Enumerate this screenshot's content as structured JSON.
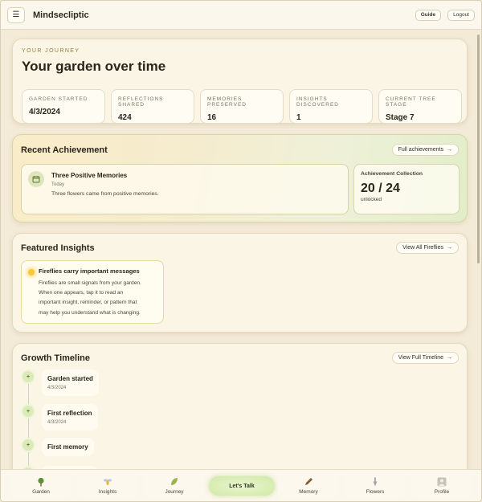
{
  "app": {
    "name": "Mindsecliptic",
    "guide_label": "Guide",
    "logout_label": "Logout"
  },
  "journey": {
    "eyebrow": "YOUR JOURNEY",
    "title": "Your garden over time",
    "stats": [
      {
        "label": "GARDEN STARTED",
        "value": "4/3/2024"
      },
      {
        "label": "REFLECTIONS SHARED",
        "value": "424"
      },
      {
        "label": "MEMORIES PRESERVED",
        "value": "16"
      },
      {
        "label": "INSIGHTS DISCOVERED",
        "value": "1"
      },
      {
        "label": "CURRENT TREE STAGE",
        "value": "Stage 7"
      }
    ]
  },
  "achievement": {
    "title": "Recent Achievement",
    "link_label": "Full achievements",
    "memory_title": "Three Positive Memories",
    "memory_date": "Today",
    "memory_desc": "Three flowers came from positive memories.",
    "collection_label": "Achievement Collection",
    "collection_value": "20 / 24",
    "collection_sub": "unlocked"
  },
  "insights": {
    "title": "Featured Insights",
    "link_label": "View All Fireflies",
    "firefly_title": "Fireflies carry important messages",
    "firefly_lines": [
      "Fireflies are small signals from your garden.",
      "When one appears, tap it to read an",
      "important insight, reminder, or pattern that",
      "may help you understand what is changing."
    ]
  },
  "timeline": {
    "title": "Growth Timeline",
    "link_label": "View Full Timeline",
    "items": [
      {
        "title": "Garden started",
        "date": "4/3/2024"
      },
      {
        "title": "First reflection",
        "date": "4/3/2024"
      },
      {
        "title": "First memory",
        "date": ""
      }
    ]
  },
  "nav": {
    "items": [
      {
        "label": "Garden",
        "icon": "tree-icon"
      },
      {
        "label": "Insights",
        "icon": "firefly-icon"
      },
      {
        "label": "Journey",
        "icon": "leaf-icon"
      },
      {
        "label": "Memory",
        "icon": "pencil-icon"
      },
      {
        "label": "Flowers",
        "icon": "trowel-icon"
      },
      {
        "label": "Profile",
        "icon": "profile-icon"
      }
    ],
    "talk_label": "Let's Talk"
  }
}
